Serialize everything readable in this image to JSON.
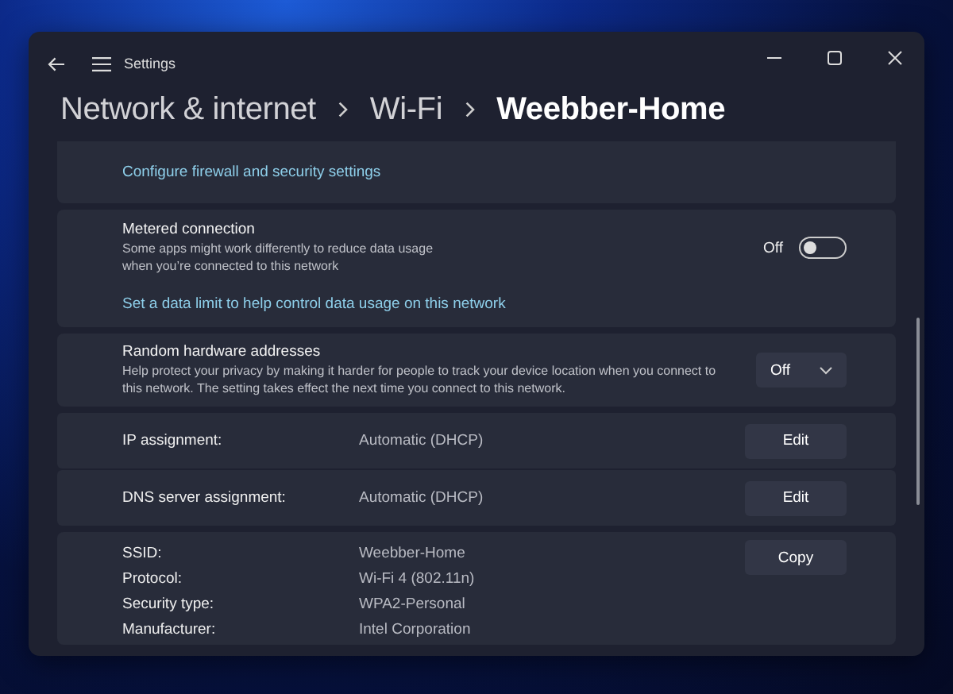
{
  "window": {
    "title": "Settings"
  },
  "breadcrumb": [
    {
      "label": "Network & internet",
      "current": false
    },
    {
      "label": "Wi-Fi",
      "current": false
    },
    {
      "label": "Weebber-Home",
      "current": true
    }
  ],
  "cards": [
    {
      "kind": "link",
      "link": "Configure firewall and security settings"
    },
    {
      "kind": "toggle",
      "title": "Metered connection",
      "description": "Some apps might work differently to reduce data usage when you’re connected to this network",
      "state_label": "Off",
      "on": false,
      "link": "Set a data limit to help control data usage on this network"
    },
    {
      "kind": "dropdown",
      "title": "Random hardware addresses",
      "description": "Help protect your privacy by making it harder for people to track your device location when you connect to this network. The setting takes effect the next time you connect to this network.",
      "value": "Off"
    },
    {
      "kind": "edit",
      "rows": [
        {
          "label": "IP assignment:",
          "value": "Automatic (DHCP)",
          "button": "Edit"
        },
        {
          "label": "DNS server assignment:",
          "value": "Automatic (DHCP)",
          "button": "Edit"
        }
      ]
    },
    {
      "kind": "properties",
      "button": "Copy",
      "rows": [
        {
          "label": "SSID:",
          "value": "Weebber-Home"
        },
        {
          "label": "Protocol:",
          "value": "Wi-Fi 4 (802.11n)"
        },
        {
          "label": "Security type:",
          "value": "WPA2-Personal"
        },
        {
          "label": "Manufacturer:",
          "value": "Intel Corporation"
        }
      ]
    }
  ]
}
